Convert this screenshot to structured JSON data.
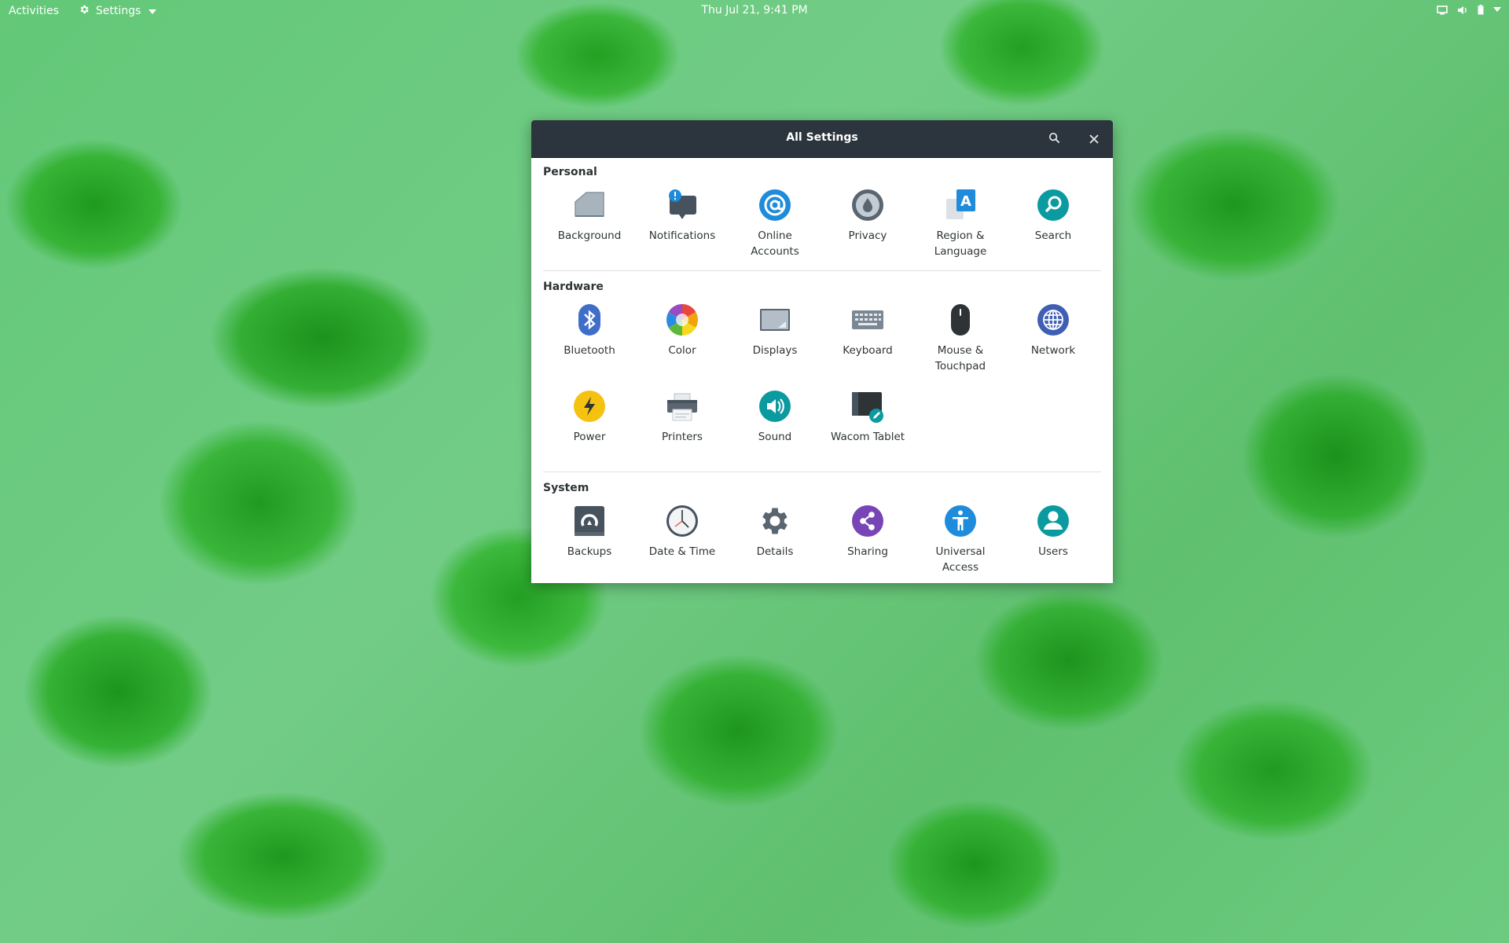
{
  "topbar": {
    "activities": "Activities",
    "app_menu": "Settings",
    "clock": "Thu Jul 21,  9:41 PM"
  },
  "window": {
    "title": "All Settings",
    "sections": [
      {
        "title": "Personal",
        "items": [
          {
            "label": "Background",
            "icon": "background-icon"
          },
          {
            "label": "Notifications",
            "icon": "notifications-icon"
          },
          {
            "label": "Online\nAccounts",
            "icon": "online-accounts-icon"
          },
          {
            "label": "Privacy",
            "icon": "privacy-icon"
          },
          {
            "label": "Region &\nLanguage",
            "icon": "region-language-icon"
          },
          {
            "label": "Search",
            "icon": "search-icon"
          }
        ]
      },
      {
        "title": "Hardware",
        "items": [
          {
            "label": "Bluetooth",
            "icon": "bluetooth-icon"
          },
          {
            "label": "Color",
            "icon": "color-icon"
          },
          {
            "label": "Displays",
            "icon": "displays-icon"
          },
          {
            "label": "Keyboard",
            "icon": "keyboard-icon"
          },
          {
            "label": "Mouse &\nTouchpad",
            "icon": "mouse-icon"
          },
          {
            "label": "Network",
            "icon": "network-icon"
          },
          {
            "label": "Power",
            "icon": "power-icon"
          },
          {
            "label": "Printers",
            "icon": "printer-icon"
          },
          {
            "label": "Sound",
            "icon": "sound-icon"
          },
          {
            "label": "Wacom Tablet",
            "icon": "wacom-tablet-icon"
          }
        ]
      },
      {
        "title": "System",
        "items": [
          {
            "label": "Backups",
            "icon": "backups-icon"
          },
          {
            "label": "Date & Time",
            "icon": "clock-icon"
          },
          {
            "label": "Details",
            "icon": "gear-icon"
          },
          {
            "label": "Sharing",
            "icon": "share-icon"
          },
          {
            "label": "Universal\nAccess",
            "icon": "accessibility-icon"
          },
          {
            "label": "Users",
            "icon": "user-icon"
          }
        ]
      }
    ]
  },
  "colors": {
    "headerbar": "#2c353d",
    "accent_blue": "#1e8bdb",
    "teal": "#0b9a9f",
    "purple": "#7745b5"
  }
}
